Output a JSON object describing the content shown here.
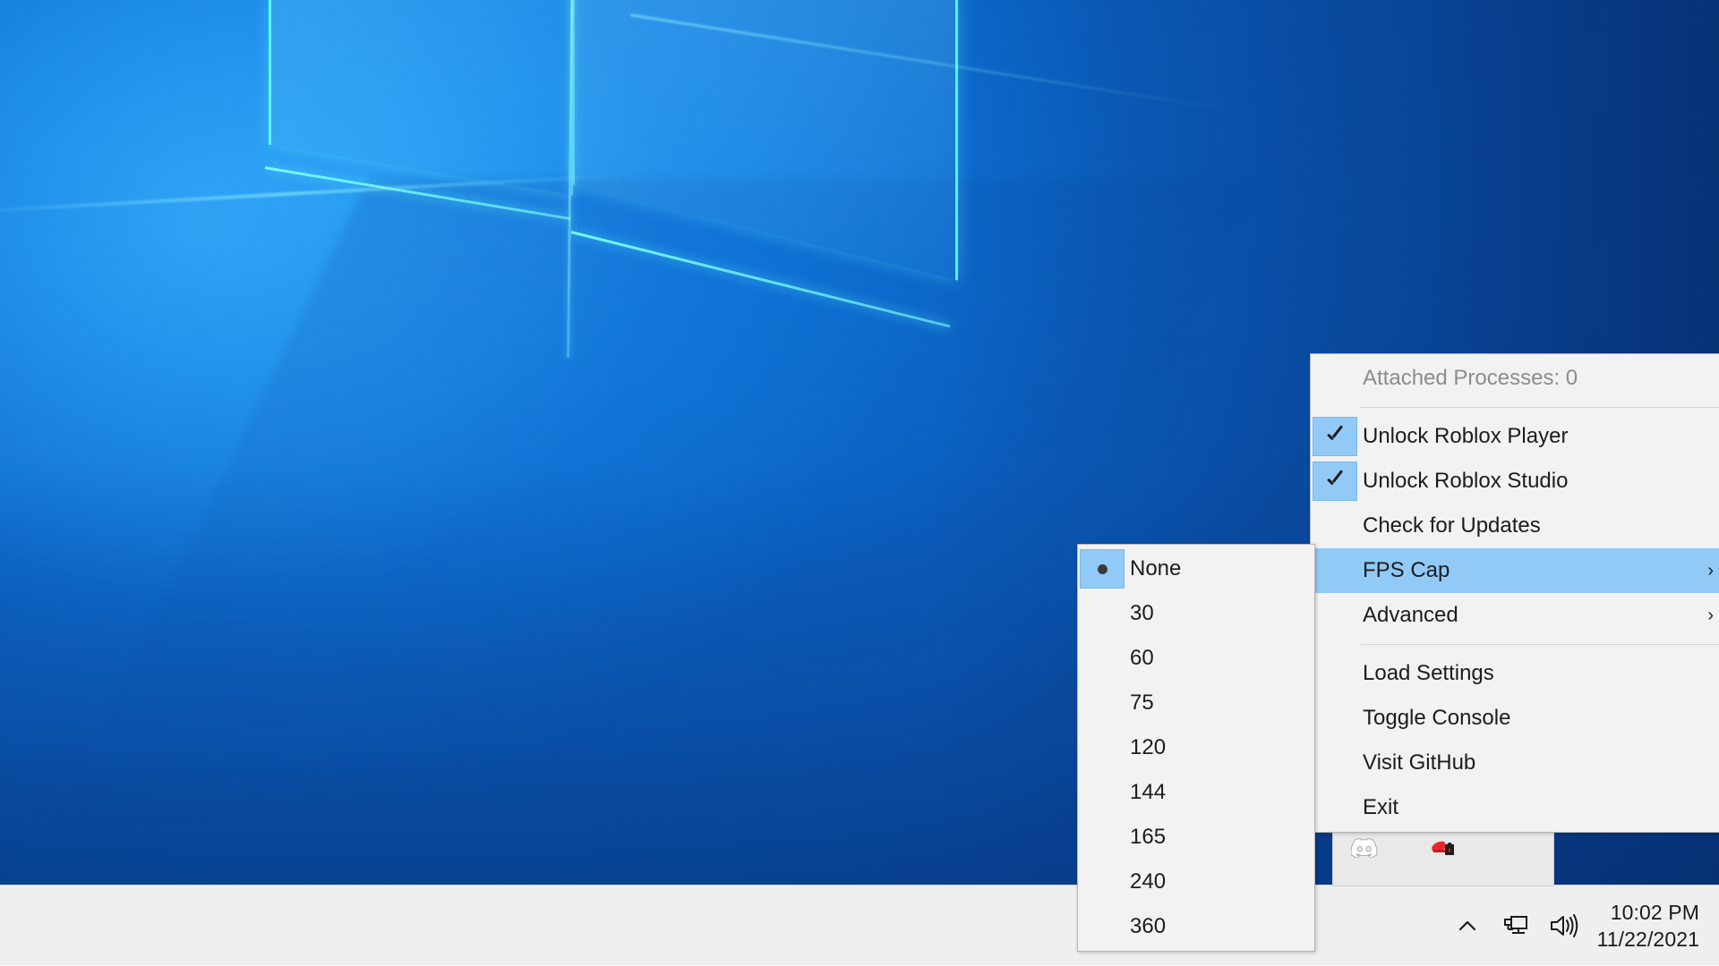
{
  "desktop": {
    "wallpaper_name": "windows-10-hero-wallpaper",
    "background_color": "#0b62c4"
  },
  "taskbar": {
    "background_color": "#efefef",
    "show_hidden_icons": {
      "icon": "chevron-up-icon",
      "glyph": "∧"
    },
    "network": {
      "icon": "network-icon",
      "label": "Network"
    },
    "volume": {
      "icon": "speaker-icon",
      "label": "Volume"
    },
    "clock": {
      "time": "10:02 PM",
      "date": "11/22/2021"
    }
  },
  "tray_flyout": {
    "visible": true,
    "icons": [
      {
        "name": "discord-icon",
        "label": "Discord"
      },
      {
        "name": "rbxfpsunlocker-icon",
        "label": "Roblox FPS Unlocker"
      }
    ]
  },
  "context_menu": {
    "highlight_color": "#91c9f7",
    "items": [
      {
        "id": "attached-processes",
        "label": "Attached Processes: 0",
        "type": "static",
        "disabled": true,
        "checked": false,
        "submenu": false,
        "highlight": false
      },
      {
        "id": "separator-1",
        "type": "separator"
      },
      {
        "id": "unlock-roblox-player",
        "label": "Unlock Roblox Player",
        "type": "checkbox",
        "disabled": false,
        "checked": true,
        "submenu": false,
        "highlight": false
      },
      {
        "id": "unlock-roblox-studio",
        "label": "Unlock Roblox Studio",
        "type": "checkbox",
        "disabled": false,
        "checked": true,
        "submenu": false,
        "highlight": false
      },
      {
        "id": "check-for-updates",
        "label": "Check for Updates",
        "type": "command",
        "disabled": false,
        "checked": false,
        "submenu": false,
        "highlight": false
      },
      {
        "id": "fps-cap",
        "label": "FPS Cap",
        "type": "submenu",
        "disabled": false,
        "checked": false,
        "submenu": true,
        "highlight": true,
        "arrow": "›"
      },
      {
        "id": "advanced",
        "label": "Advanced",
        "type": "submenu",
        "disabled": false,
        "checked": false,
        "submenu": true,
        "highlight": false,
        "arrow": "›"
      },
      {
        "id": "separator-2",
        "type": "separator"
      },
      {
        "id": "load-settings",
        "label": "Load Settings",
        "type": "command",
        "disabled": false,
        "checked": false,
        "submenu": false,
        "highlight": false
      },
      {
        "id": "toggle-console",
        "label": "Toggle Console",
        "type": "command",
        "disabled": false,
        "checked": false,
        "submenu": false,
        "highlight": false
      },
      {
        "id": "visit-github",
        "label": "Visit GitHub",
        "type": "command",
        "disabled": false,
        "checked": false,
        "submenu": false,
        "highlight": false
      },
      {
        "id": "exit",
        "label": "Exit",
        "type": "command",
        "disabled": false,
        "checked": false,
        "submenu": false,
        "highlight": false
      }
    ]
  },
  "fps_cap_submenu": {
    "parent": "FPS Cap",
    "selected": "None",
    "items": [
      {
        "id": "fps-none",
        "label": "None",
        "selected": true
      },
      {
        "id": "fps-30",
        "label": "30",
        "selected": false
      },
      {
        "id": "fps-60",
        "label": "60",
        "selected": false
      },
      {
        "id": "fps-75",
        "label": "75",
        "selected": false
      },
      {
        "id": "fps-120",
        "label": "120",
        "selected": false
      },
      {
        "id": "fps-144",
        "label": "144",
        "selected": false
      },
      {
        "id": "fps-165",
        "label": "165",
        "selected": false
      },
      {
        "id": "fps-240",
        "label": "240",
        "selected": false
      },
      {
        "id": "fps-360",
        "label": "360",
        "selected": false
      }
    ]
  }
}
